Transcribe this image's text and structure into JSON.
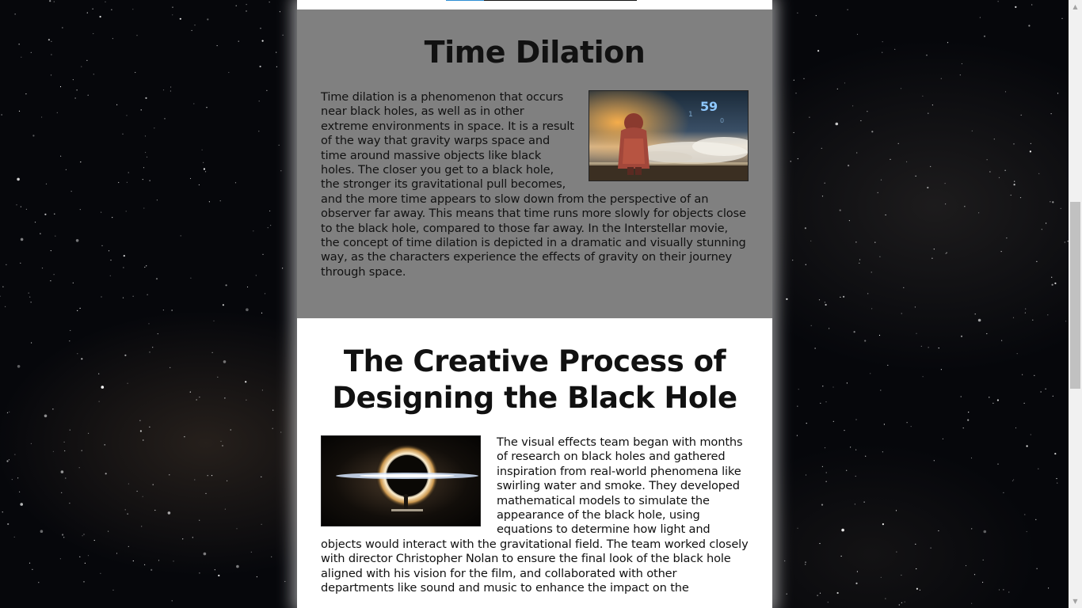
{
  "progress": {
    "fraction": 0.2
  },
  "time_dilation": {
    "title": "Time Dilation",
    "text": "Time dilation is a phenomenon that occurs near black holes, as well as in other extreme environments in space. It is a result of the way that gravity warps space and time around massive objects like black holes. The closer you get to a black hole, the stronger its gravitational pull becomes, and the more time appears to slow down from the perspective of an observer far away. This means that time runs more slowly for objects close to the black hole, compared to those far away. In the Interstellar movie, the concept of time dilation is depicted in a dramatic and visually stunning way, as the characters experience the effects of gravity on their journey through space.",
    "image_overlay": "59"
  },
  "creative_process": {
    "title": "The Creative Process of Designing the Black Hole",
    "text": "The visual effects team began with months of research on black holes and gathered inspiration from real-world phenomena like swirling water and smoke. They developed mathematical models to simulate the appearance of the black hole, using equations to determine how light and objects would interact with the gravitational field. The team worked closely with director Christopher Nolan to ensure the final look of the black hole aligned with his vision for the film, and collaborated with other departments like sound and music to enhance the impact on the"
  },
  "scrollbar": {
    "up_glyph": "▲",
    "down_glyph": "▼"
  },
  "colors": {
    "section_gray": "#808080",
    "progress_accent": "#2d8fd5"
  }
}
